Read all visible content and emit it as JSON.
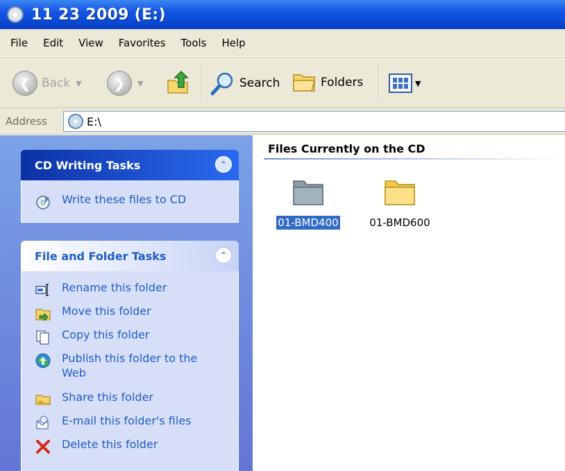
{
  "window": {
    "title": "11 23 2009 (E:)"
  },
  "menu": [
    "File",
    "Edit",
    "View",
    "Favorites",
    "Tools",
    "Help"
  ],
  "toolbar": {
    "back_label": "Back",
    "search_label": "Search",
    "folders_label": "Folders"
  },
  "address": {
    "label": "Address",
    "value": "E:\\"
  },
  "cd_tasks": {
    "title": "CD Writing Tasks",
    "items": [
      {
        "label": "Write these files to CD",
        "icon": "write-cd-icon"
      }
    ]
  },
  "folder_tasks": {
    "title": "File and Folder Tasks",
    "items": [
      {
        "label": "Rename this folder",
        "icon": "rename-icon"
      },
      {
        "label": "Move this folder",
        "icon": "move-icon"
      },
      {
        "label": "Copy this folder",
        "icon": "copy-icon"
      },
      {
        "label": "Publish this folder to the Web",
        "icon": "publish-web-icon"
      },
      {
        "label": "Share this folder",
        "icon": "share-icon"
      },
      {
        "label": "E-mail this folder's files",
        "icon": "email-icon"
      },
      {
        "label": "Delete this folder",
        "icon": "delete-icon"
      }
    ]
  },
  "content": {
    "group_title": "Files Currently on the CD",
    "files": [
      {
        "name": "01-BMD400",
        "selected": true
      },
      {
        "name": "01-BMD600",
        "selected": false
      }
    ]
  },
  "colors": {
    "accent": "#215dc6",
    "selection": "#316ac5",
    "titlebar": "#0a4bd8"
  }
}
